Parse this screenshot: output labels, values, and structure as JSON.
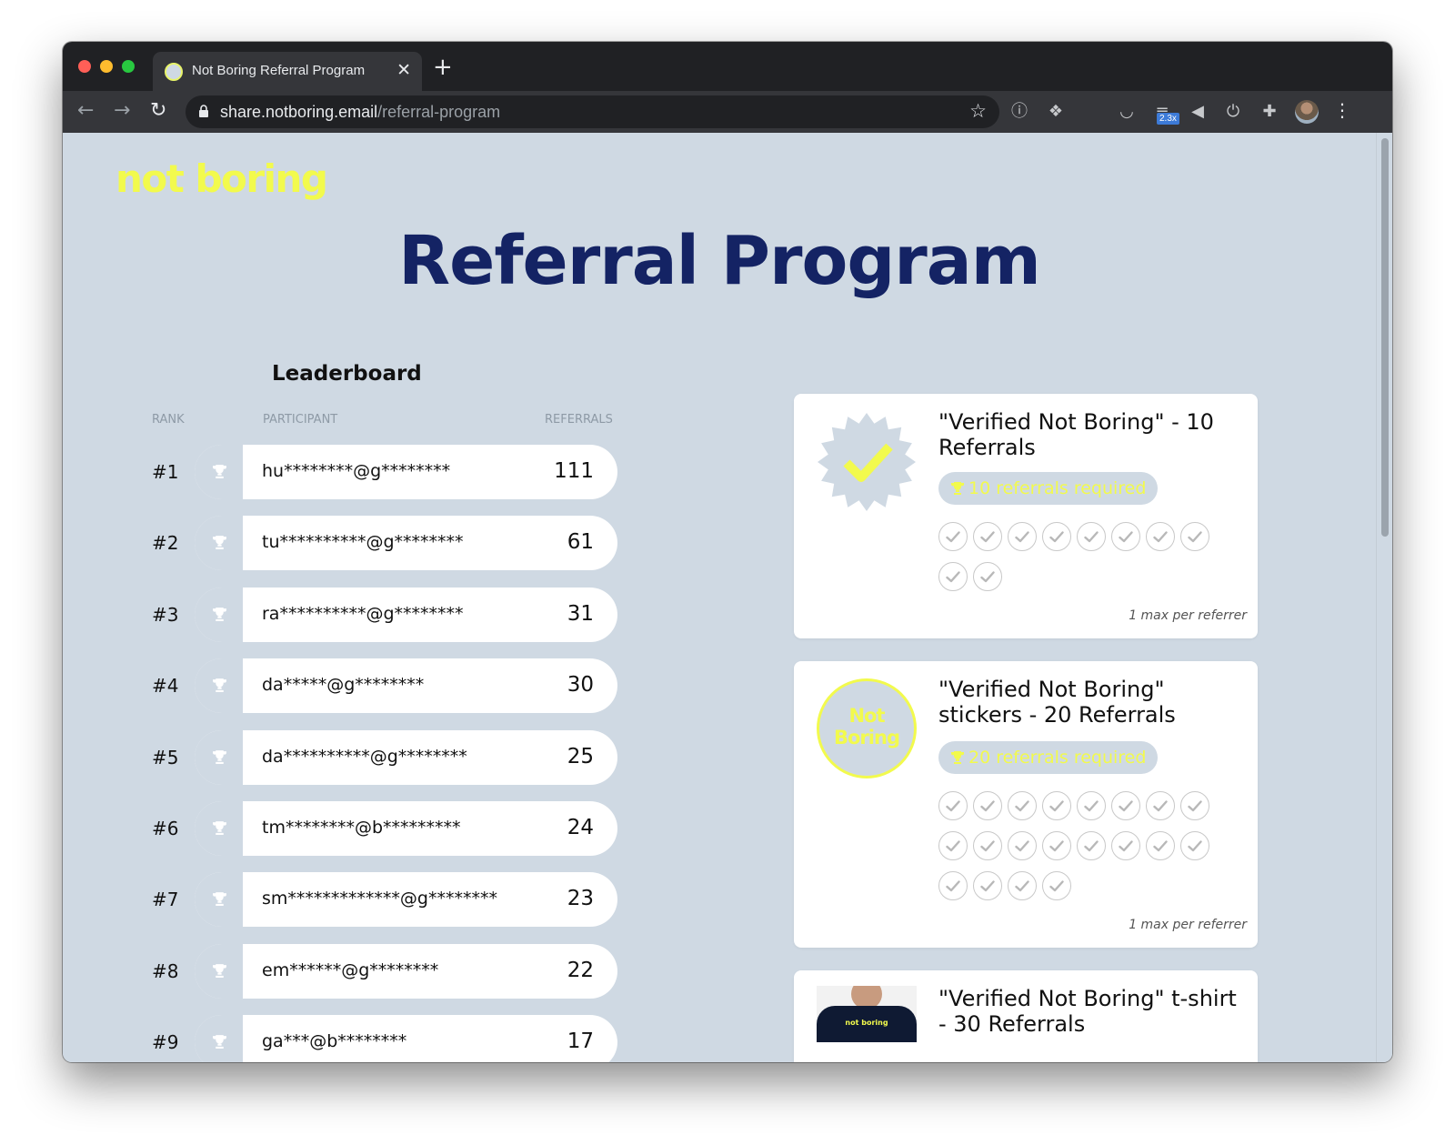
{
  "browser": {
    "tab_title": "Not Boring Referral Program",
    "tab_close": "✕",
    "new_tab": "+",
    "url_host": "share.notboring.email",
    "url_path": "/referral-program",
    "zoom_badge": "2.3x"
  },
  "page": {
    "logo": "not boring",
    "title": "Referral Program"
  },
  "leaderboard": {
    "title": "Leaderboard",
    "columns": {
      "rank": "RANK",
      "participant": "PARTICIPANT",
      "referrals": "REFERRALS"
    },
    "rows": [
      {
        "rank": "#1",
        "participant": "hu********@g********",
        "referrals": "111"
      },
      {
        "rank": "#2",
        "participant": "tu**********@g********",
        "referrals": "61"
      },
      {
        "rank": "#3",
        "participant": "ra**********@g********",
        "referrals": "31"
      },
      {
        "rank": "#4",
        "participant": "da*****@g********",
        "referrals": "30"
      },
      {
        "rank": "#5",
        "participant": "da**********@g********",
        "referrals": "25"
      },
      {
        "rank": "#6",
        "participant": "tm********@b*********",
        "referrals": "24"
      },
      {
        "rank": "#7",
        "participant": "sm*************@g********",
        "referrals": "23"
      },
      {
        "rank": "#8",
        "participant": "em******@g********",
        "referrals": "22"
      },
      {
        "rank": "#9",
        "participant": "ga***@b********",
        "referrals": "17"
      }
    ]
  },
  "rewards": [
    {
      "title": "\"Verified Not Boring\" - 10 Referrals",
      "required": "10 referrals required",
      "checks": 10,
      "note": "1 max per referrer",
      "image": "verified-badge"
    },
    {
      "title": "\"Verified Not Boring\" stickers - 20 Referrals",
      "required": "20 referrals required",
      "checks": 20,
      "note": "1 max per referrer",
      "image": "sticker",
      "sticker_text": "Not Boring"
    },
    {
      "title": "\"Verified Not Boring\" t-shirt - 30 Referrals",
      "image": "tshirt",
      "shirt_text": "not boring"
    }
  ],
  "colors": {
    "background": "#cfd9e3",
    "title": "#142364",
    "accent_yellow": "#f2fa4d"
  }
}
